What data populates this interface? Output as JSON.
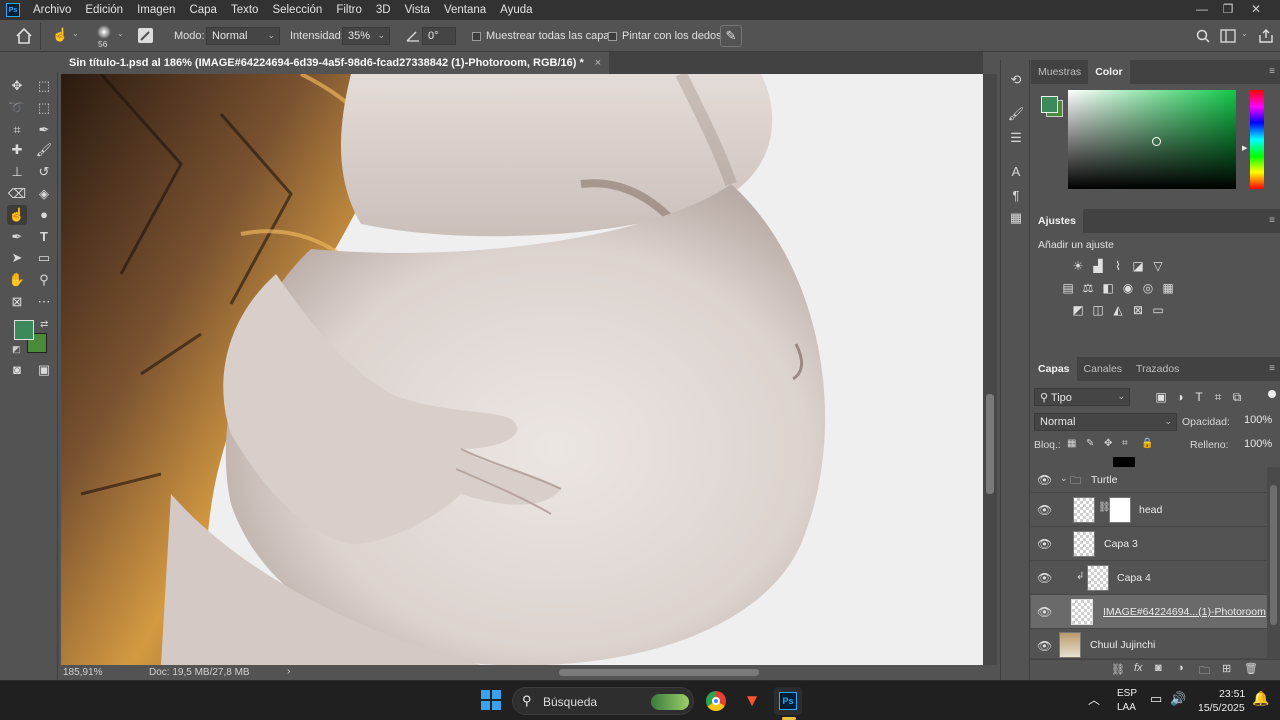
{
  "app": {
    "logo_text": "Ps"
  },
  "menubar": {
    "items": [
      "Archivo",
      "Edición",
      "Imagen",
      "Capa",
      "Texto",
      "Selección",
      "Filtro",
      "3D",
      "Vista",
      "Ventana",
      "Ayuda"
    ]
  },
  "window_controls": {
    "minimize": "—",
    "restore": "❐",
    "close": "✕"
  },
  "options": {
    "brush_size": "56",
    "mode_label": "Modo:",
    "mode_value": "Normal",
    "intensity_label": "Intensidad:",
    "intensity_value": "35%",
    "angle_value": "0°",
    "sample_all_label": "Muestrear todas las capas",
    "finger_paint_label": "Pintar con los dedos"
  },
  "document": {
    "tab_title": "Sin título-1.psd al 186% (IMAGE#64224694-6d39-4a5f-98d6-fcad27338842 (1)-Photoroom, RGB/16) *",
    "tab_close": "×",
    "zoom": "185,91%",
    "doc_info": "Doc: 19,5 MB/27,8 MB"
  },
  "color_panel": {
    "tabs": [
      "Muestras",
      "Color"
    ],
    "active_tab": "Color",
    "fg_color": "#3a8a5a",
    "bg_color": "#4a8a3a",
    "hue_color": "#12c84a"
  },
  "adjustments_panel": {
    "tab": "Ajustes",
    "add_label": "Añadir un ajuste"
  },
  "layers_panel": {
    "tabs": [
      "Capas",
      "Canales",
      "Trazados"
    ],
    "active_tab": "Capas",
    "filter_kind": "Tipo",
    "blend_mode": "Normal",
    "opacity_label": "Opacidad:",
    "opacity_value": "100%",
    "lock_label": "Bloq.:",
    "fill_label": "Relleno:",
    "fill_value": "100%",
    "layers": [
      {
        "name": "Turtle",
        "type": "group"
      },
      {
        "name": "head",
        "type": "layer-mask"
      },
      {
        "name": "Capa 3",
        "type": "layer"
      },
      {
        "name": "Capa 4",
        "type": "clipped"
      },
      {
        "name": "IMAGE#64224694...(1)-Photoroom",
        "type": "layer",
        "selected": true
      },
      {
        "name": "Chuul Jujinchi",
        "type": "layer"
      }
    ]
  },
  "taskbar": {
    "search_placeholder": "Búsqueda",
    "lang_line1": "ESP",
    "lang_line2": "LAA",
    "time": "23:51",
    "date": "15/5/2025"
  }
}
